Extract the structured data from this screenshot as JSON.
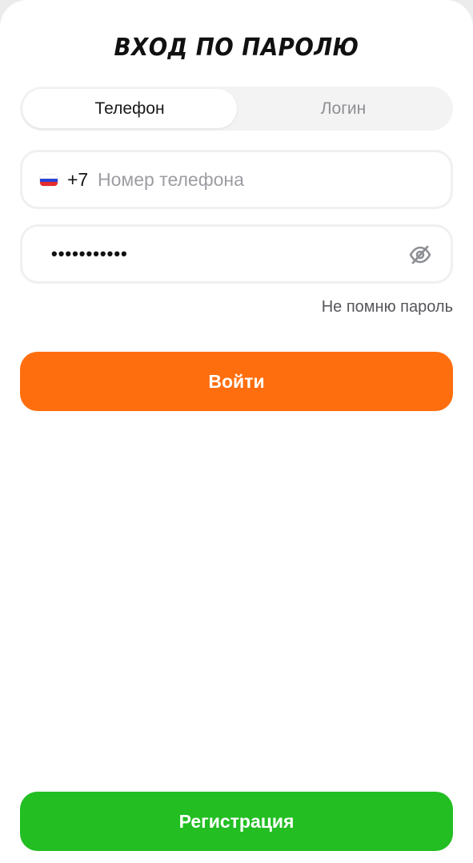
{
  "page": {
    "title": "ВХОД ПО ПАРОЛЮ"
  },
  "tabs": [
    {
      "label": "Телефон",
      "active": true
    },
    {
      "label": "Логин",
      "active": false
    }
  ],
  "phone_field": {
    "country_flag": "russia-flag-icon",
    "prefix": "+7",
    "value": "",
    "placeholder": "Номер телефона"
  },
  "password_field": {
    "masked_value": "•••••••••••",
    "visibility_icon": "eye-off-icon"
  },
  "forgot_link": "Не помню пароль",
  "buttons": {
    "login": "Войти",
    "register": "Регистрация"
  },
  "colors": {
    "login_button": "#FF6E0E",
    "register_button": "#22BE22",
    "tab_track": "#F3F3F4"
  }
}
